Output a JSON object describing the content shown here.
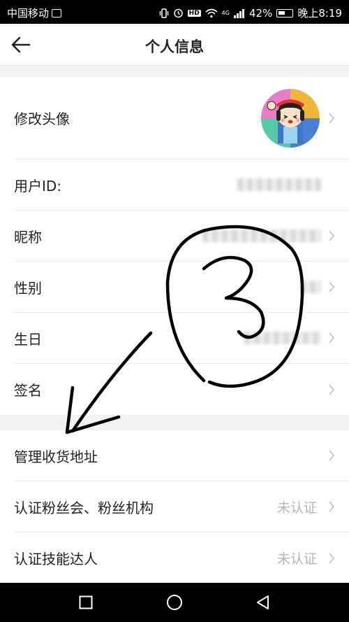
{
  "status_bar": {
    "carrier": "中国移动",
    "network": "4G",
    "battery_percent": "42%",
    "time": "晚上8:19",
    "icons": [
      "vibrate-icon",
      "alarm-icon",
      "hd-icon",
      "wifi-icon",
      "signal-icon",
      "battery-icon"
    ]
  },
  "header": {
    "title": "个人信息"
  },
  "rows_group1": [
    {
      "label": "修改头像",
      "value": "",
      "kind": "avatar"
    },
    {
      "label": "用户ID:",
      "value": "",
      "kind": "hidden"
    },
    {
      "label": "昵称",
      "value": "",
      "kind": "hidden"
    },
    {
      "label": "性别",
      "value": "",
      "kind": "hidden"
    },
    {
      "label": "生日",
      "value": "",
      "kind": "hidden"
    },
    {
      "label": "签名",
      "value": "",
      "kind": "plain"
    }
  ],
  "rows_group2": [
    {
      "label": "管理收货地址",
      "value": ""
    },
    {
      "label": "认证粉丝会、粉丝机构",
      "value": "未认证"
    },
    {
      "label": "认证技能达人",
      "value": "未认证"
    }
  ],
  "annotation": {
    "text": "3",
    "color": "#000000"
  },
  "colors": {
    "chevron": "#bdbdbd",
    "status_value": "#b5b5b5"
  }
}
